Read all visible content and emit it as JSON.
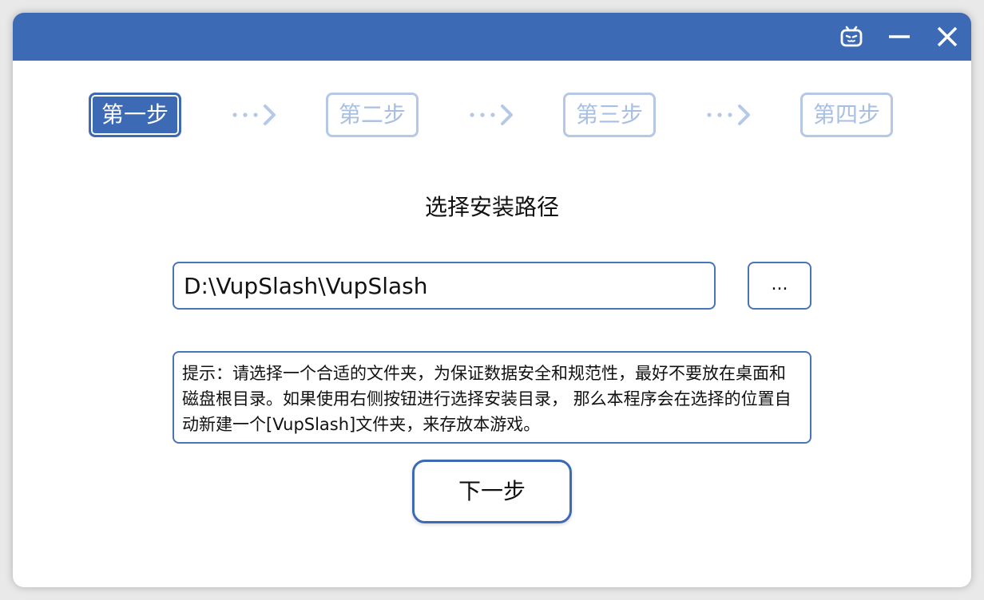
{
  "colors": {
    "accent": "#3d6ab4",
    "inactive": "#b5c8e6",
    "inactive_text": "#a9bfe2",
    "background": "#ffffff"
  },
  "titlebar": {
    "icons": [
      "bilibili-tv-icon",
      "minimize-icon",
      "close-icon"
    ]
  },
  "steps": [
    {
      "label": "第一步",
      "active": true
    },
    {
      "label": "第二步",
      "active": false
    },
    {
      "label": "第三步",
      "active": false
    },
    {
      "label": "第四步",
      "active": false
    }
  ],
  "main": {
    "heading": "选择安装路径",
    "path_value": "D:\\VupSlash\\VupSlash",
    "browse_label": "...",
    "hint": "提示：请选择一个合适的文件夹，为保证数据安全和规范性，最好不要放在桌面和磁盘根目录。如果使用右侧按钮进行选择安装目录， 那么本程序会在选择的位置自动新建一个[VupSlash]文件夹，来存放本游戏。",
    "next_label": "下一步"
  }
}
